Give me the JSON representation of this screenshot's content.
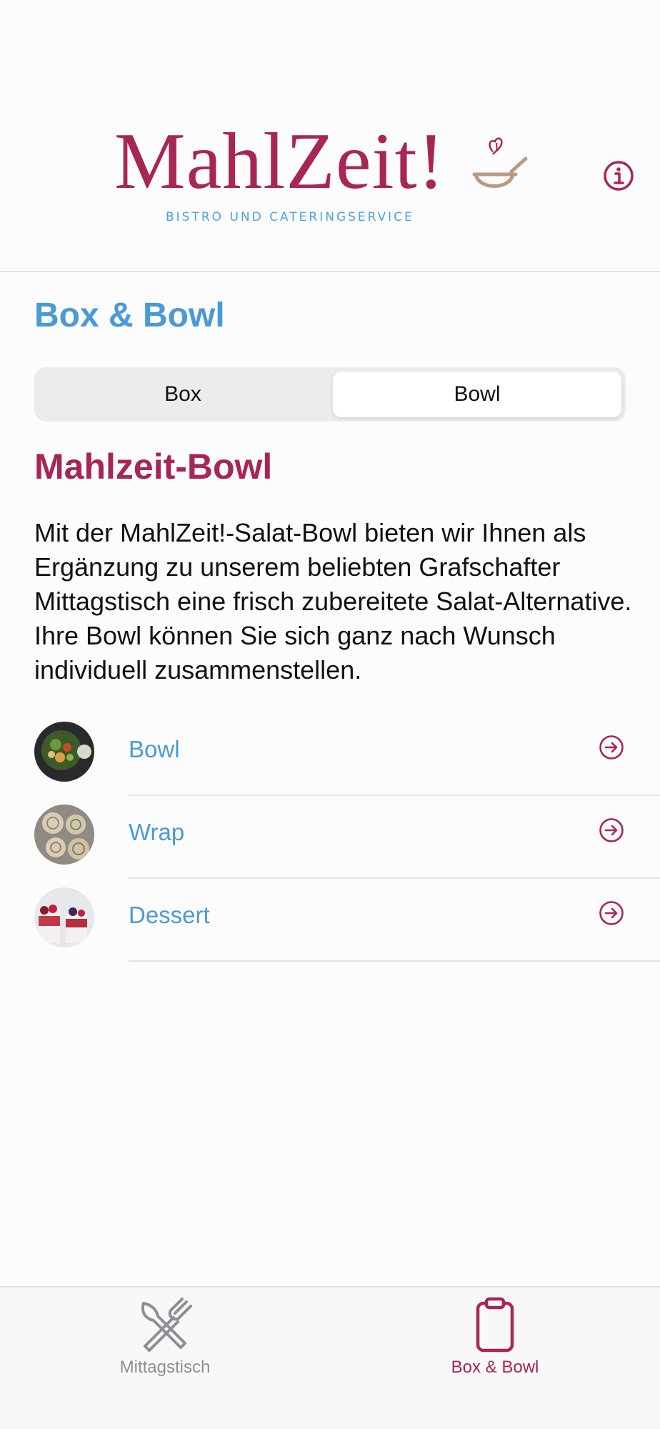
{
  "header": {
    "logo_text": "MahlZeit!",
    "logo_subtitle": "BISTRO UND CATERINGSERVICE",
    "info_icon": "info-circle-icon"
  },
  "page": {
    "title": "Box & Bowl"
  },
  "segmented_control": {
    "options": [
      "Box",
      "Bowl"
    ],
    "selected": "Bowl"
  },
  "content": {
    "title": "Mahlzeit-Bowl",
    "description": "Mit der MahlZeit!-Salat-Bowl bieten wir Ihnen als Ergänzung zu unserem beliebten Grafschafter Mittagstisch eine frisch zubereitete Salat-Alternative. Ihre Bowl können Sie sich ganz nach Wunsch individuell zusammenstellen."
  },
  "items": [
    {
      "label": "Bowl",
      "icon": "arrow-right-circle-icon"
    },
    {
      "label": "Wrap",
      "icon": "arrow-right-circle-icon"
    },
    {
      "label": "Dessert",
      "icon": "arrow-right-circle-icon"
    }
  ],
  "tabbar": {
    "tabs": [
      {
        "label": "Mittagstisch",
        "icon": "fork-knife-icon",
        "active": false
      },
      {
        "label": "Box & Bowl",
        "icon": "clipboard-icon",
        "active": true
      }
    ]
  },
  "colors": {
    "brand": "#a72656",
    "accent": "#4a9ad6",
    "inactive": "#8e8e93"
  }
}
